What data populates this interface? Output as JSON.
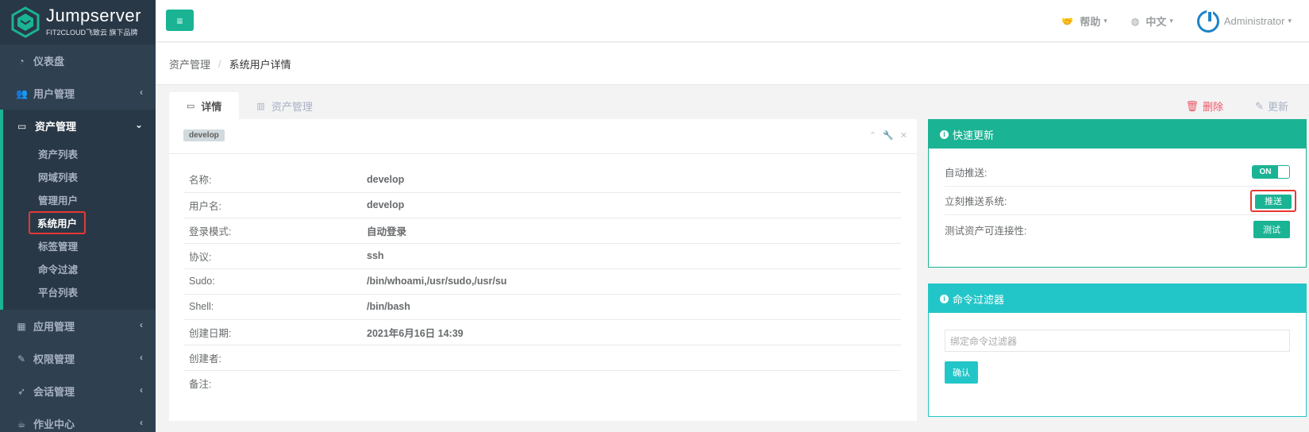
{
  "brand": {
    "title": "Jumpserver",
    "subtitle": "FIT2CLOUD飞致云 旗下品牌"
  },
  "sidebar": {
    "items_top": [
      {
        "label": "仪表盘",
        "icon": "dashboard-icon"
      },
      {
        "label": "用户管理",
        "icon": "users-icon"
      }
    ],
    "active": {
      "label": "资产管理",
      "icon": "inbox-icon",
      "children": [
        "资产列表",
        "网域列表",
        "管理用户",
        "系统用户",
        "标签管理",
        "命令过滤",
        "平台列表"
      ],
      "current": "系统用户"
    },
    "items_bottom": [
      {
        "label": "应用管理",
        "icon": "grid-icon"
      },
      {
        "label": "权限管理",
        "icon": "edit-icon"
      },
      {
        "label": "会话管理",
        "icon": "rocket-icon"
      },
      {
        "label": "作业中心",
        "icon": "coffee-icon"
      }
    ]
  },
  "topbar": {
    "help": "帮助",
    "language": "中文",
    "user": "Administrator"
  },
  "breadcrumb": {
    "parent": "资产管理",
    "separator": "/",
    "current": "系统用户详情"
  },
  "tabs": {
    "detail": "详情",
    "assets": "资产管理"
  },
  "actions": {
    "delete": "删除",
    "update": "更新"
  },
  "detail": {
    "tag": "develop",
    "rows": [
      {
        "key": "名称:",
        "value": "develop"
      },
      {
        "key": "用户名:",
        "value": "develop"
      },
      {
        "key": "登录模式:",
        "value": "自动登录"
      },
      {
        "key": "协议:",
        "value": "ssh"
      },
      {
        "key": "Sudo:",
        "value": "/bin/whoami,/usr/sudo,/usr/su"
      },
      {
        "key": "Shell:",
        "value": "/bin/bash"
      },
      {
        "key": "创建日期:",
        "value": "2021年6月16日 14:39"
      },
      {
        "key": "创建者:",
        "value": ""
      },
      {
        "key": "备注:",
        "value": ""
      }
    ]
  },
  "quick_update": {
    "title": "快速更新",
    "auto_push_label": "自动推送:",
    "auto_push_state": "ON",
    "push_now_label": "立刻推送系统:",
    "push_button": "推送",
    "test_label": "测试资产可连接性:",
    "test_button": "测试"
  },
  "command_filter": {
    "title": "命令过滤器",
    "placeholder": "绑定命令过滤器",
    "confirm": "确认"
  },
  "colors": {
    "primary": "#1ab394",
    "info": "#23c6c8",
    "danger": "#ed5565",
    "sidebar": "#2f4050",
    "highlight": "#e53935"
  }
}
